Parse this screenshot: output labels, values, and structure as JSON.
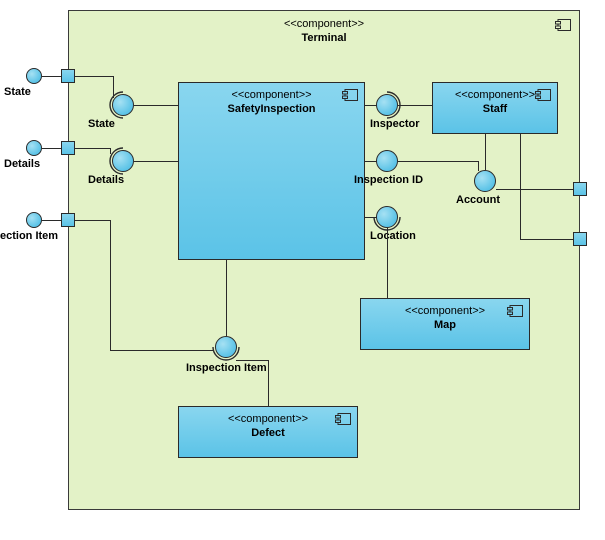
{
  "stereotype": "<<component>>",
  "terminal": {
    "name": "Terminal"
  },
  "components": {
    "safetyInspection": {
      "name": "SafetyInspection"
    },
    "staff": {
      "name": "Staff"
    },
    "map": {
      "name": "Map"
    },
    "defect": {
      "name": "Defect"
    }
  },
  "interfaces": {
    "state_ext": "State",
    "details_ext": "Details",
    "inspectionItem_ext": "ection Item",
    "state": "State",
    "details": "Details",
    "inspector": "Inspector",
    "inspectionId": "Inspection ID",
    "location": "Location",
    "account": "Account",
    "inspectionItem": "Inspection Item"
  },
  "chart_data": {
    "type": "uml-component-diagram",
    "container": "Terminal",
    "components": [
      "SafetyInspection",
      "Staff",
      "Map",
      "Defect"
    ],
    "provided_interfaces": {
      "SafetyInspection": [
        "State",
        "Details",
        "Inspector",
        "Inspection ID",
        "Location",
        "Inspection Item"
      ],
      "Staff": [
        "Account"
      ]
    },
    "required_interfaces": {
      "Staff": [
        "Inspector"
      ],
      "Map": [
        "Location"
      ],
      "Defect": [
        "Inspection Item"
      ]
    },
    "delegated_ports": {
      "Terminal_left": [
        "State",
        "Details",
        "Inspection Item"
      ],
      "Terminal_right": [
        "(unlabeled)",
        "(unlabeled)"
      ]
    },
    "external_provided_left": [
      "State",
      "Details",
      "ection Item"
    ]
  }
}
